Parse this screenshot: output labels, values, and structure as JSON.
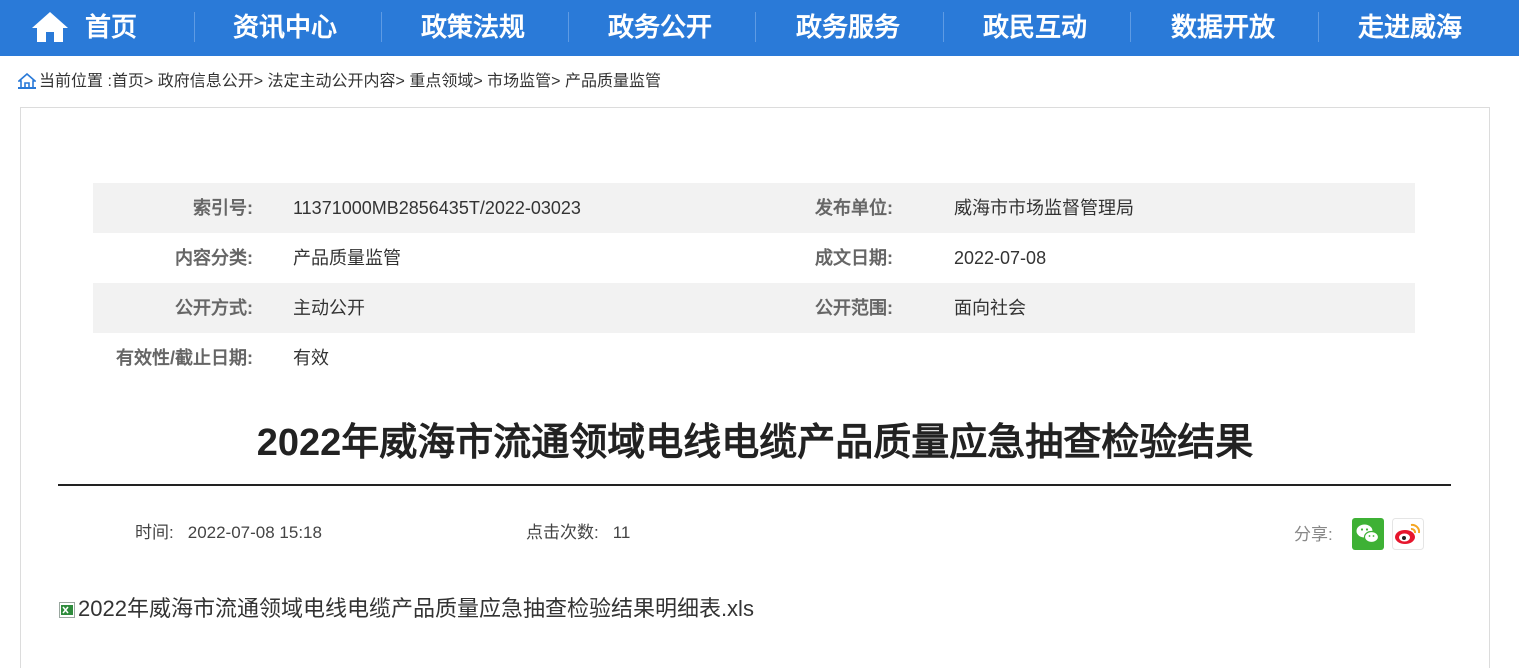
{
  "nav": {
    "items": [
      "首页",
      "资讯中心",
      "政策法规",
      "政务公开",
      "政务服务",
      "政民互动",
      "数据开放",
      "走进威海"
    ],
    "home_icon": "home-icon",
    "bg_color": "#2a7ad8"
  },
  "breadcrumb": {
    "prefix": "当前位置 :",
    "items": [
      "首页",
      "政府信息公开",
      "法定主动公开内容",
      "重点领域",
      "市场监管",
      "产品质量监管"
    ],
    "separator": ">"
  },
  "meta": {
    "index_label": "索引号:",
    "index_value": "11371000MB2856435T/2022-03023",
    "publisher_label": "发布单位:",
    "publisher_value": "威海市市场监督管理局",
    "category_label": "内容分类:",
    "category_value": "产品质量监管",
    "date_label": "成文日期:",
    "date_value": "2022-07-08",
    "method_label": "公开方式:",
    "method_value": "主动公开",
    "scope_label": "公开范围:",
    "scope_value": "面向社会",
    "validity_label": "有效性/截止日期:",
    "validity_value": "有效"
  },
  "article": {
    "title": "2022年威海市流通领域电线电缆产品质量应急抽查检验结果",
    "time_label": "时间:",
    "time_value": "2022-07-08 15:18",
    "clicks_label": "点击次数:",
    "clicks_value": "11",
    "share_label": "分享:",
    "attachment": "2022年威海市流通领域电线电缆产品质量应急抽查检验结果明细表.xls"
  }
}
